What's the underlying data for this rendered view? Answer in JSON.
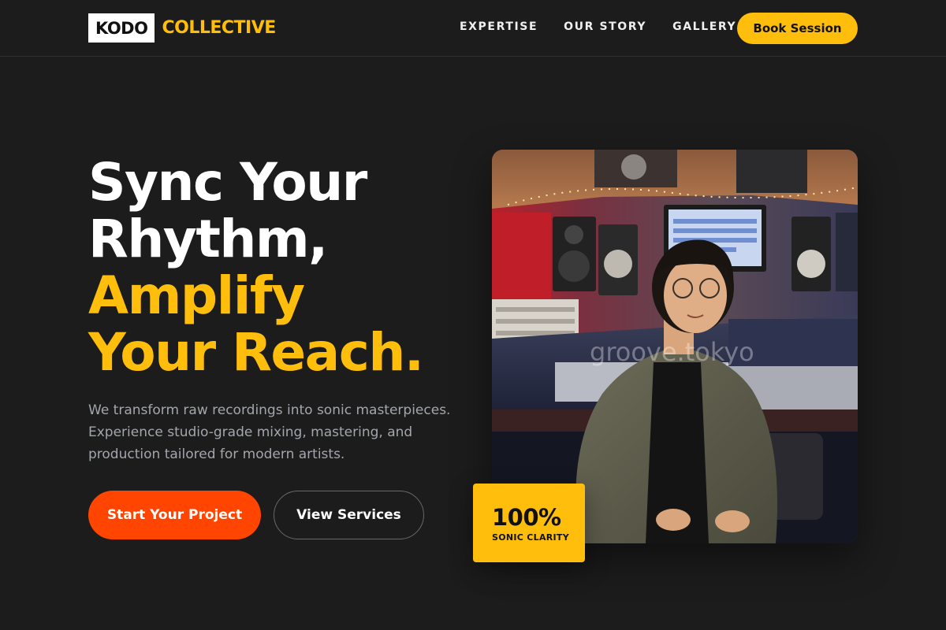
{
  "brand": {
    "logo_box": "KODO",
    "logo_word": "COLLECTIVE"
  },
  "nav": {
    "items": [
      {
        "label": "EXPERTISE"
      },
      {
        "label": "OUR STORY"
      },
      {
        "label": "GALLERY"
      }
    ],
    "cta_label": "Book Session"
  },
  "hero": {
    "headline_lines": [
      {
        "text": "Sync Your",
        "color": "white"
      },
      {
        "text": "Rhythm,",
        "color": "white"
      },
      {
        "text": "Amplify",
        "color": "yellow"
      },
      {
        "text": "Your Reach.",
        "color": "yellow"
      }
    ],
    "subtext": "We transform raw recordings into sonic masterpieces. Experience studio-grade mixing, mastering, and production tailored for modern artists.",
    "primary_button": "Start Your Project",
    "secondary_button": "View Services"
  },
  "photo": {
    "watermark": "groove.tokyo"
  },
  "stat": {
    "value": "100%",
    "label": "SONIC CLARITY"
  },
  "colors": {
    "background": "#1c1c1c",
    "accent_yellow": "#ffbe0b",
    "accent_orange": "#ff4500",
    "muted_text": "#a3a6ad"
  },
  "icons": {}
}
